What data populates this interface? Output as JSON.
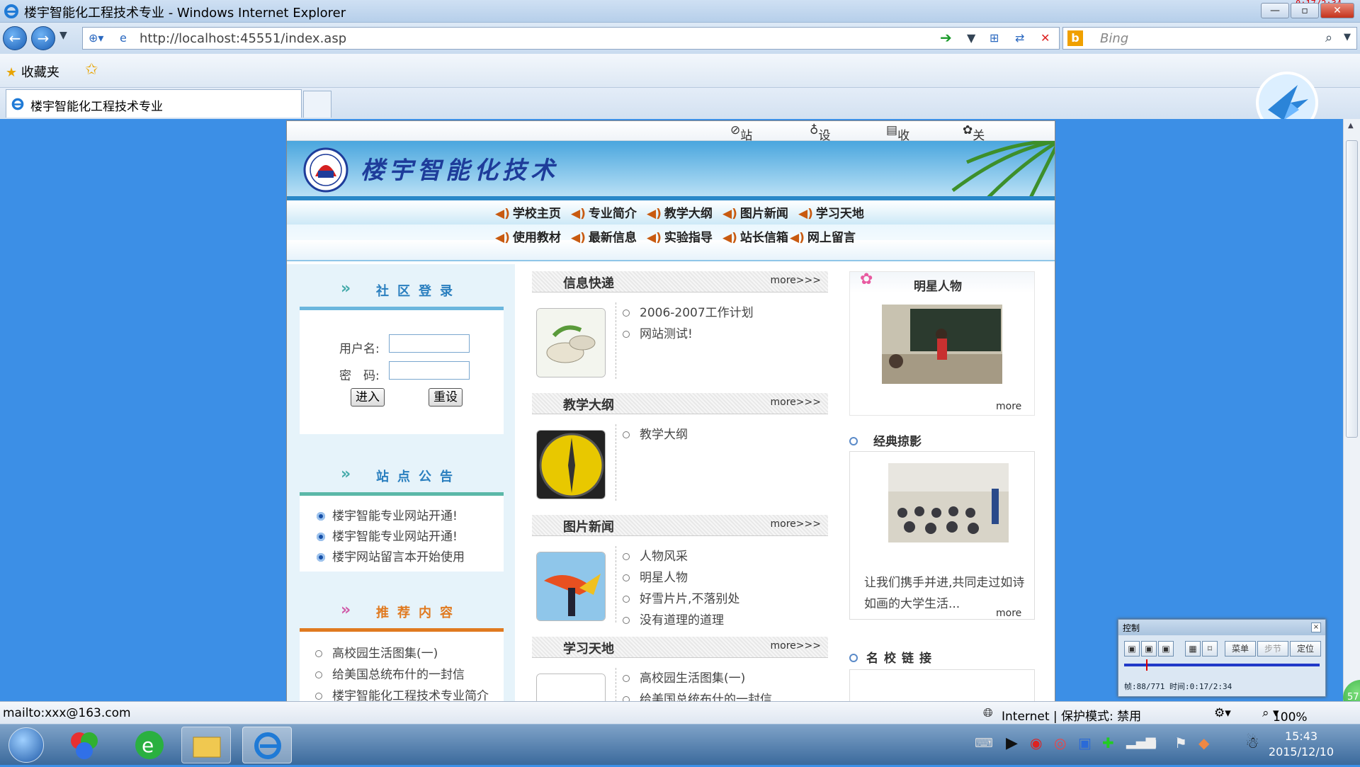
{
  "window": {
    "title": "楼宇智能化工程技术专业 - Windows Internet Explorer",
    "recording_time": "0:17/2:34"
  },
  "address_bar": {
    "url": "http://localhost:45551/index.asp"
  },
  "search": {
    "placeholder": "Bing"
  },
  "favorites": {
    "label": "收藏夹"
  },
  "tab": {
    "label": "楼宇智能化工程技术专业"
  },
  "site": {
    "topnav": [
      "站点导航",
      "设置首页",
      "收藏站点",
      "关于我们"
    ],
    "title": "楼宇智能化技术",
    "menu_row1": [
      "学校主页",
      "专业简介",
      "教学大纲",
      "图片新闻",
      "学习天地"
    ],
    "menu_row2": [
      "使用教材",
      "最新信息",
      "实验指导",
      "站长信箱",
      "网上留言"
    ]
  },
  "login": {
    "header": "社区登录",
    "username_label": "用户名:",
    "password_label": "密　码:",
    "enter_button": "进入",
    "reset_button": "重设"
  },
  "notice": {
    "header": "站点公告",
    "items": [
      "楼宇智能专业网站开通!",
      "楼宇智能专业网站开通!",
      "楼宇网站留言本开始使用"
    ]
  },
  "recommend": {
    "header": "推荐内容",
    "items": [
      "高校园生活图集(一)",
      "给美国总统布什的一封信",
      "楼宇智能化工程技术专业简介"
    ]
  },
  "sections": [
    {
      "title": "信息快递",
      "more": "more>>>",
      "items": [
        "2006-2007工作计划",
        "网站测试!"
      ]
    },
    {
      "title": "教学大纲",
      "more": "more>>>",
      "items": [
        "教学大纲"
      ]
    },
    {
      "title": "图片新闻",
      "more": "more>>>",
      "items": [
        "人物风采",
        "明星人物",
        "好雪片片,不落别处",
        "没有道理的道理"
      ]
    },
    {
      "title": "学习天地",
      "more": "more>>>",
      "items": [
        "高校园生活图集(一)",
        "给美国总统布什的一封信"
      ]
    }
  ],
  "right": {
    "star_header": "明星人物",
    "star_more": "more",
    "classic_header": "经典掠影",
    "classic_text": "让我们携手并进,共同走过如诗如画的大学生活...",
    "classic_more": "more",
    "links_header": "名校链接"
  },
  "status": {
    "link": "mailto:xxx@163.com",
    "zone": "Internet | 保护模式: 禁用",
    "zoom": "100%"
  },
  "clock": {
    "time": "15:43",
    "date": "2015/12/10"
  },
  "control_panel": {
    "title": "控制",
    "menu_btn": "菜单",
    "step_btn": "步节",
    "locate_btn": "定位",
    "frame_info": "帧:88/771 时间:0:17/2:34",
    "progress": 0.114
  },
  "badge": {
    "value": "57"
  },
  "colors": {
    "page_bg": "#3c8fe6",
    "accent": "#2a7fbf",
    "menu_icon": "#c85a10"
  }
}
